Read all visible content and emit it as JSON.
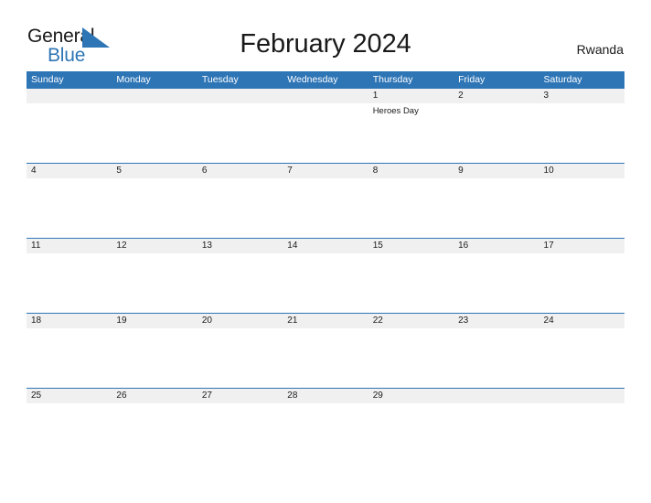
{
  "brand": {
    "name_part1": "General",
    "name_part2": "Blue",
    "triangle_icon": "triangle-logo-icon",
    "accent_color": "#2e75b6"
  },
  "header": {
    "title": "February 2024",
    "region": "Rwanda"
  },
  "calendar": {
    "month": "February",
    "year": "2024",
    "weekday_headers": [
      "Sunday",
      "Monday",
      "Tuesday",
      "Wednesday",
      "Thursday",
      "Friday",
      "Saturday"
    ],
    "header_bg": "#2e75b6",
    "daynum_band_bg": "#f0f0f0",
    "grid_line_color": "#2e75b6",
    "weeks": [
      {
        "days": [
          {
            "num": "",
            "events": []
          },
          {
            "num": "",
            "events": []
          },
          {
            "num": "",
            "events": []
          },
          {
            "num": "",
            "events": []
          },
          {
            "num": "1",
            "events": [
              "Heroes Day"
            ]
          },
          {
            "num": "2",
            "events": []
          },
          {
            "num": "3",
            "events": []
          }
        ]
      },
      {
        "days": [
          {
            "num": "4",
            "events": []
          },
          {
            "num": "5",
            "events": []
          },
          {
            "num": "6",
            "events": []
          },
          {
            "num": "7",
            "events": []
          },
          {
            "num": "8",
            "events": []
          },
          {
            "num": "9",
            "events": []
          },
          {
            "num": "10",
            "events": []
          }
        ]
      },
      {
        "days": [
          {
            "num": "11",
            "events": []
          },
          {
            "num": "12",
            "events": []
          },
          {
            "num": "13",
            "events": []
          },
          {
            "num": "14",
            "events": []
          },
          {
            "num": "15",
            "events": []
          },
          {
            "num": "16",
            "events": []
          },
          {
            "num": "17",
            "events": []
          }
        ]
      },
      {
        "days": [
          {
            "num": "18",
            "events": []
          },
          {
            "num": "19",
            "events": []
          },
          {
            "num": "20",
            "events": []
          },
          {
            "num": "21",
            "events": []
          },
          {
            "num": "22",
            "events": []
          },
          {
            "num": "23",
            "events": []
          },
          {
            "num": "24",
            "events": []
          }
        ]
      },
      {
        "days": [
          {
            "num": "25",
            "events": []
          },
          {
            "num": "26",
            "events": []
          },
          {
            "num": "27",
            "events": []
          },
          {
            "num": "28",
            "events": []
          },
          {
            "num": "29",
            "events": []
          },
          {
            "num": "",
            "events": []
          },
          {
            "num": "",
            "events": []
          }
        ]
      }
    ]
  }
}
